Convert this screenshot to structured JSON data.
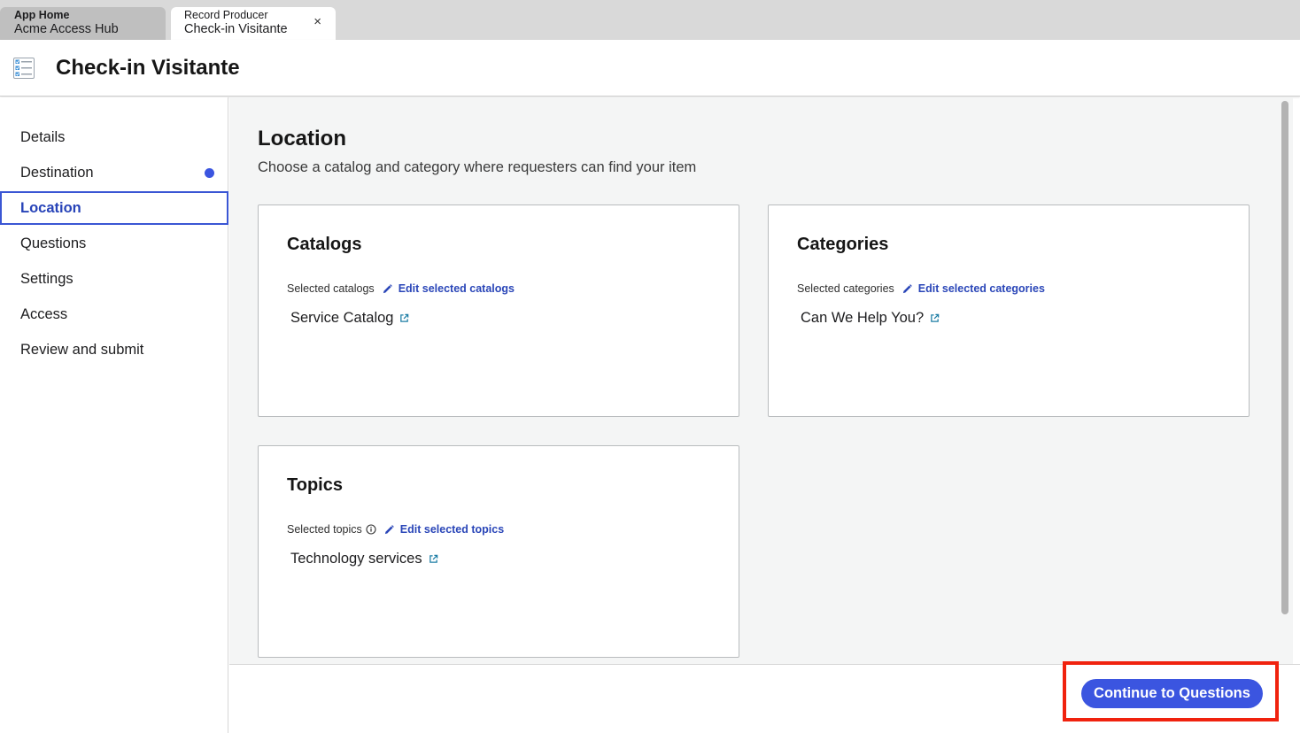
{
  "tabs": [
    {
      "line1": "App Home",
      "line2": "Acme Access Hub"
    },
    {
      "line1": "Record Producer",
      "line2": "Check-in Visitante",
      "close": "×"
    }
  ],
  "header": {
    "title": "Check-in Visitante",
    "icon": "form-checklist-icon"
  },
  "sidebar": {
    "items": [
      {
        "label": "Details"
      },
      {
        "label": "Destination"
      },
      {
        "label": "Location"
      },
      {
        "label": "Questions"
      },
      {
        "label": "Settings"
      },
      {
        "label": "Access"
      },
      {
        "label": "Review and submit"
      }
    ]
  },
  "main": {
    "title": "Location",
    "subtitle": "Choose a catalog and category where requesters can find your item",
    "cards": {
      "catalogs": {
        "title": "Catalogs",
        "label": "Selected catalogs",
        "edit": "Edit selected catalogs",
        "value": "Service Catalog"
      },
      "categories": {
        "title": "Categories",
        "label": "Selected categories",
        "edit": "Edit selected categories",
        "value": "Can We Help You?"
      },
      "topics": {
        "title": "Topics",
        "label": "Selected topics",
        "edit": "Edit selected topics",
        "value": "Technology services"
      }
    }
  },
  "footer": {
    "primary_button": "Continue to Questions"
  },
  "colors": {
    "accent": "#3b55e0",
    "link": "#2a46b8",
    "highlight": "#f0220e",
    "panel_bg": "#f4f5f5"
  }
}
